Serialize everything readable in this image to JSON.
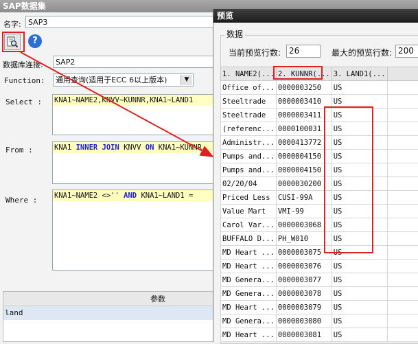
{
  "left_window": {
    "title": "SAP数据集",
    "name_label": "名字:",
    "name_value": "SAP3",
    "db_label": "数据库连接:",
    "db_value": "SAP2",
    "function_label": "Function:",
    "function_value": "通用查询(适用于ECC 6以上版本)",
    "select_label": "Select :",
    "select_value": "KNA1~NAME2,KNVV~KUNNR,KNA1~LAND1",
    "from_label": "From :",
    "from_parts": [
      "KNA1 ",
      "INNER JOIN",
      " KNVV ",
      "ON",
      " KNA1~KUNNR"
    ],
    "where_label": "Where :",
    "where_parts": [
      "KNA1~NAME2 <>'' ",
      "AND",
      " KNA1~LAND1 ="
    ],
    "param_header": "参数",
    "param_row": "land",
    "help_glyph": "?"
  },
  "preview_window": {
    "title": "预览",
    "group_label": "数据",
    "current_rows_label": "当前预览行数:",
    "current_rows_value": "26",
    "max_rows_label": "最大的预览行数:",
    "max_rows_value": "200",
    "columns": [
      "1. NAME2(...",
      "2. KUNNR(...",
      "3. LAND1(..."
    ],
    "rows": [
      [
        "Office of...",
        "0000003250",
        "US"
      ],
      [
        "Steeltrade",
        "0000003410",
        "US"
      ],
      [
        "Steeltrade",
        "0000003411",
        "US"
      ],
      [
        "(referenc...",
        "0000100031",
        "US"
      ],
      [
        "Administr...",
        "0000413772",
        "US"
      ],
      [
        "Pumps and...",
        "0000004150",
        "US"
      ],
      [
        "Pumps and...",
        "0000004150",
        "US"
      ],
      [
        "02/20/04",
        "0000030200",
        "US"
      ],
      [
        "Priced Less",
        "CUSI-99A",
        "US"
      ],
      [
        "Value Mart",
        "VMI-99",
        "US"
      ],
      [
        "Carol Var...",
        "0000003068",
        "US"
      ],
      [
        "BUFFALO D...",
        "PH_W010",
        "US"
      ],
      [
        "MD Heart ...",
        "0000003075",
        "US"
      ],
      [
        "MD Heart ...",
        "0000003076",
        "US"
      ],
      [
        "MD Genera...",
        "0000003077",
        "US"
      ],
      [
        "MD Genera...",
        "0000003078",
        "US"
      ],
      [
        "MD Heart ...",
        "0000003079",
        "US"
      ],
      [
        "MD Genera...",
        "0000003080",
        "US"
      ],
      [
        "MD Heart ...",
        "0000003081",
        "US"
      ]
    ]
  },
  "icons": {
    "preview": "preview-document-icon",
    "help": "help-icon",
    "dropdown": "chevron-down-icon"
  },
  "colors": {
    "highlight": "#e02020",
    "sql_background": "#ffffc0",
    "sql_keyword": "#2020d0",
    "selected_row": "#dde8f4"
  }
}
